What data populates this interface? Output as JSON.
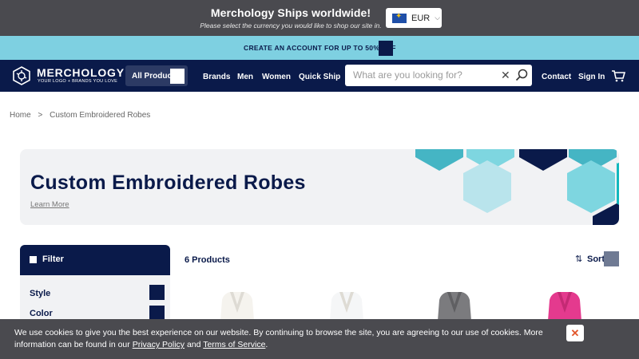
{
  "currency_bar": {
    "title": "Merchology Ships worldwide!",
    "subtitle": "Please select the currency you would like to shop our site in.",
    "selected_currency": "EUR"
  },
  "promo": {
    "text": "CREATE AN ACCOUNT FOR UP TO 50% OFF"
  },
  "nav": {
    "logo_name": "MERCHOLOGY",
    "logo_tagline": "YOUR LOGO + BRANDS YOU LOVE",
    "all_products": "All Products",
    "links": [
      "Brands",
      "Men",
      "Women",
      "Quick Ship"
    ],
    "search_placeholder": "What are you looking for?",
    "contact": "Contact",
    "sign_in": "Sign In"
  },
  "breadcrumb": {
    "home": "Home",
    "separator": ">",
    "current": "Custom Embroidered Robes"
  },
  "hero": {
    "title": "Custom Embroidered Robes",
    "link": "Learn More"
  },
  "filter": {
    "label": "Filter",
    "facets": [
      "Style",
      "Color"
    ]
  },
  "products": {
    "count_label": "6 Products",
    "sort_label": "Sort"
  },
  "robe_colors": [
    "#f5f3ee",
    "#f5f6f7",
    "#7b7b7e",
    "#e43a8e"
  ],
  "cookie": {
    "text_before": "We use cookies to give you the best experience on our website. By continuing to browse the site, you are agreeing to our use of cookies. More information can be found in our ",
    "privacy_link": "Privacy Policy",
    "and": " and ",
    "terms_link": "Terms of Service",
    "end": ".",
    "close": "✕"
  },
  "colors": {
    "navy": "#0a1a4a",
    "teal_light": "#7ed0e1",
    "teal": "#45b5c4",
    "teal_bright": "#13b7bd",
    "hero_bg": "#f1f2f4"
  }
}
